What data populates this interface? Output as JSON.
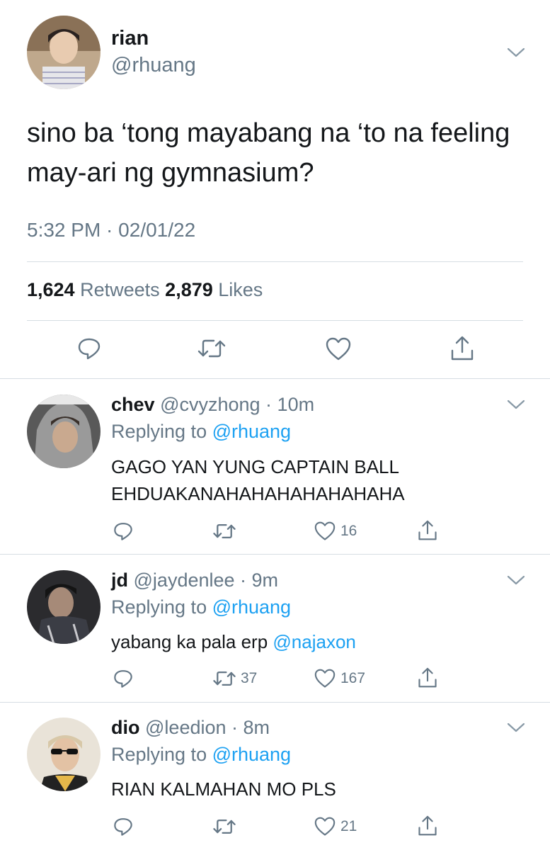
{
  "main_tweet": {
    "author_name": "rian",
    "author_handle": "@rhuang",
    "text": "sino ba ‘tong mayabang na ‘to na feeling may-ari ng gymnasium?",
    "time": "5:32 PM",
    "date_sep": " · ",
    "date": "02/01/22",
    "retweet_count": "1,624",
    "retweet_label": "Retweets",
    "like_count": "2,879",
    "like_label": "Likes",
    "actions": [
      "reply-icon",
      "retweet-icon",
      "like-icon",
      "share-icon"
    ]
  },
  "replies": [
    {
      "name": "chev",
      "handle": "@cvyzhong",
      "sep": " · ",
      "time": "10m",
      "replying_prefix": "Replying to ",
      "replying_to": "@rhuang",
      "text_line1": "GAGO YAN YUNG CAPTAIN BALL",
      "text_line2": "EHDUAKANAHAHAHAHAHAHAHA",
      "retweets": "",
      "likes": "16"
    },
    {
      "name": "jd",
      "handle": "@jaydenlee",
      "sep": " · ",
      "time": "9m",
      "replying_prefix": "Replying to ",
      "replying_to": "@rhuang",
      "text": "yabang ka pala erp ",
      "mention": "@najaxon",
      "retweets": "37",
      "likes": "167"
    },
    {
      "name": "dio",
      "handle": "@leedion",
      "sep": " · ",
      "time": "8m",
      "replying_prefix": "Replying to ",
      "replying_to": "@rhuang",
      "text": "RIAN KALMAHAN MO PLS",
      "retweets": "",
      "likes": "21"
    }
  ],
  "colors": {
    "text": "#14171a",
    "secondary": "#657786",
    "link": "#1da1f2",
    "divider": "#d6dde3"
  }
}
